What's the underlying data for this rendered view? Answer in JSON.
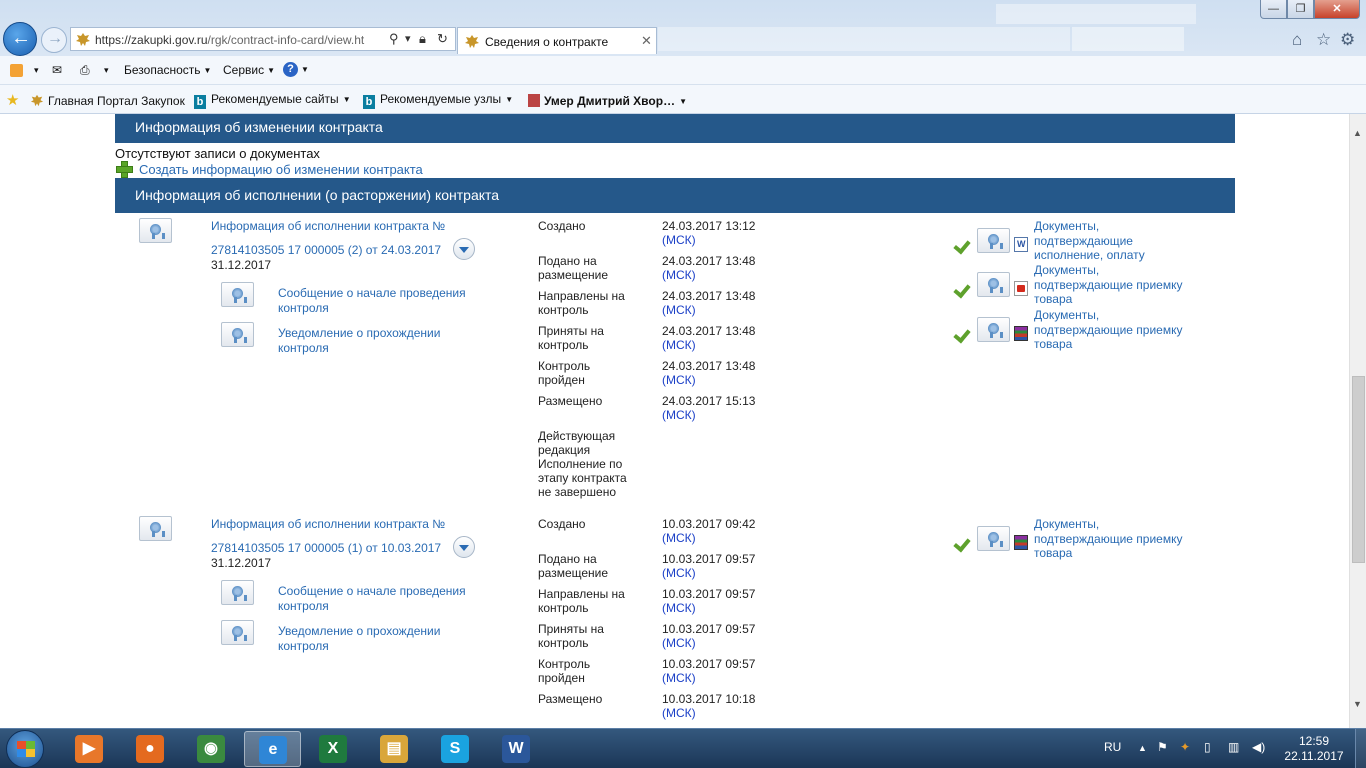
{
  "browser": {
    "url_host": "https://zakupki.gov.ru",
    "url_path": "/rgk/contract-info-card/view.ht",
    "tab_title": "Сведения о контракте",
    "tab_close": "✕",
    "window_min": "—",
    "window_max": "❐",
    "window_close": "✕",
    "icons": [
      "home-icon",
      "star-icon",
      "gear-icon",
      "search-icon",
      "lock-icon",
      "refresh-icon"
    ]
  },
  "command_bar": {
    "security": "Безопасность",
    "service": "Сервис",
    "help": "?"
  },
  "favorites_bar": {
    "items": [
      {
        "label": "Главная Портал Закупок"
      },
      {
        "label": "Рекомендуемые сайты"
      },
      {
        "label": "Рекомендуемые узлы"
      },
      {
        "label": "Умер Дмитрий Хвор…"
      }
    ]
  },
  "page": {
    "change_section": {
      "title": "Информация об изменении контракта",
      "empty_text": "Отсутствуют записи о документах",
      "create_link": "Создать информацию об изменении контракта"
    },
    "exec_section": {
      "title": "Информация об исполнении (о расторжении) контракта"
    },
    "records": [
      {
        "title_line1": "Информация об исполнении контракта №",
        "title_line2": "27814103505 17 000005 (2) от 24.03.2017",
        "date": "31.12.2017",
        "sub_links": [
          {
            "line1": "Сообщение о начале проведения",
            "line2": "контроля"
          },
          {
            "line1": "Уведомление о прохождении",
            "line2": "контроля"
          }
        ],
        "statuses": [
          {
            "label": "Создано",
            "time": "24.03.2017 13:12",
            "tz": "(МСК)"
          },
          {
            "label": "Подано на\nразмещение",
            "time": "24.03.2017 13:48",
            "tz": "(МСК)"
          },
          {
            "label": "Направлены на\nконтроль",
            "time": "24.03.2017 13:48",
            "tz": "(МСК)"
          },
          {
            "label": "Приняты на\nконтроль",
            "time": "24.03.2017 13:48",
            "tz": "(МСК)"
          },
          {
            "label": "Контроль\nпройден",
            "time": "24.03.2017 13:48",
            "tz": "(МСК)"
          },
          {
            "label": "Размещено",
            "time": "24.03.2017 15:13",
            "tz": "(МСК)"
          },
          {
            "label": "Действующая\nредакция\nИсполнение по\nэтапу контракта\nне завершено",
            "time": "",
            "tz": ""
          }
        ],
        "documents": [
          {
            "text": "Документы,\nподтверждающие\nисполнение, оплату",
            "file_type": "word"
          },
          {
            "text": "Документы,\nподтверждающие приемку\nтовара",
            "file_type": "pdf"
          },
          {
            "text": "Документы,\nподтверждающие приемку\nтовара",
            "file_type": "rar"
          }
        ]
      },
      {
        "title_line1": "Информация об исполнении контракта №",
        "title_line2": "27814103505 17 000005 (1) от 10.03.2017",
        "date": "31.12.2017",
        "sub_links": [
          {
            "line1": "Сообщение о начале проведения",
            "line2": "контроля"
          },
          {
            "line1": "Уведомление о прохождении",
            "line2": "контроля"
          }
        ],
        "statuses": [
          {
            "label": "Создано",
            "time": "10.03.2017 09:42",
            "tz": "(МСК)"
          },
          {
            "label": "Подано на\nразмещение",
            "time": "10.03.2017 09:57",
            "tz": "(МСК)"
          },
          {
            "label": "Направлены на\nконтроль",
            "time": "10.03.2017 09:57",
            "tz": "(МСК)"
          },
          {
            "label": "Приняты на\nконтроль",
            "time": "10.03.2017 09:57",
            "tz": "(МСК)"
          },
          {
            "label": "Контроль\nпройден",
            "time": "10.03.2017 09:57",
            "tz": "(МСК)"
          },
          {
            "label": "Размещено",
            "time": "10.03.2017 10:18",
            "tz": "(МСК)"
          }
        ],
        "documents": [
          {
            "text": "Документы,\nподтверждающие приемку\nтовара",
            "file_type": "rar"
          }
        ]
      }
    ]
  },
  "taskbar": {
    "apps": [
      {
        "name": "media-player",
        "color": "#e8772a",
        "glyph": "▶"
      },
      {
        "name": "firefox",
        "color": "#e46a1f",
        "glyph": "●"
      },
      {
        "name": "chrome",
        "color": "#3a8a3f",
        "glyph": "◉"
      },
      {
        "name": "internet-explorer",
        "color": "#2f86d6",
        "glyph": "e"
      },
      {
        "name": "excel",
        "color": "#1f7a3e",
        "glyph": "X"
      },
      {
        "name": "file-explorer",
        "color": "#d9a63a",
        "glyph": "▤"
      },
      {
        "name": "skype",
        "color": "#1aa3e0",
        "glyph": "S"
      },
      {
        "name": "word",
        "color": "#2b579a",
        "glyph": "W"
      }
    ],
    "language": "RU",
    "time": "12:59",
    "date": "22.11.2017"
  }
}
